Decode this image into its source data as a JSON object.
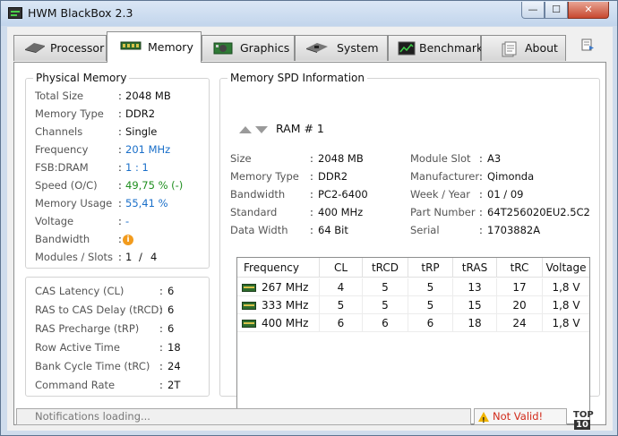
{
  "window": {
    "title": "HWM BlackBox 2.3",
    "min": "—",
    "max": "☐",
    "close": "✕"
  },
  "tabs": [
    {
      "label": "Processor",
      "icon": "cpu-icon"
    },
    {
      "label": "Memory",
      "icon": "memory-module-icon",
      "active": true
    },
    {
      "label": "Graphics",
      "icon": "graphics-card-icon"
    },
    {
      "label": "System",
      "icon": "motherboard-icon"
    },
    {
      "label": "Benchmark",
      "icon": "benchmark-chart-icon"
    },
    {
      "label": "About",
      "icon": "about-info-icon"
    }
  ],
  "physical": {
    "title": "Physical Memory",
    "rows": [
      {
        "label": "Total Size",
        "value": "2048 MB"
      },
      {
        "label": "Memory Type",
        "value": "DDR2"
      },
      {
        "label": "Channels",
        "value": "Single"
      },
      {
        "label": "Frequency",
        "value": "201 MHz"
      },
      {
        "label": "FSB:DRAM",
        "value": "1 : 1"
      },
      {
        "label": "Speed (O/C)",
        "value": "49,75 % (-)"
      },
      {
        "label": "Memory Usage",
        "value": "55,41 %"
      },
      {
        "label": "Voltage",
        "value": "-"
      },
      {
        "label": "Bandwidth",
        "value": "i"
      },
      {
        "label": "Modules / Slots",
        "value": "1",
        "value2": "4",
        "slash": "/"
      }
    ],
    "sep": ":"
  },
  "timings": {
    "rows": [
      {
        "label": "CAS Latency (CL)",
        "value": "6"
      },
      {
        "label": "RAS to CAS Delay (tRCD)",
        "value": "6"
      },
      {
        "label": "RAS Precharge (tRP)",
        "value": "6"
      },
      {
        "label": "Row Active Time",
        "value": "18"
      },
      {
        "label": "Bank Cycle Time (tRC)",
        "value": "24"
      },
      {
        "label": "Command Rate",
        "value": "2T"
      }
    ]
  },
  "spd": {
    "title": "Memory SPD Information",
    "ram_label": "RAM # 1",
    "left": [
      {
        "label": "Size",
        "value": "2048 MB"
      },
      {
        "label": "Memory Type",
        "value": "DDR2"
      },
      {
        "label": "Bandwidth",
        "value": "PC2-6400"
      },
      {
        "label": "Standard",
        "value": "400 MHz"
      },
      {
        "label": "Data Width",
        "value": "64 Bit"
      }
    ],
    "right": [
      {
        "label": "Module Slot",
        "value": "A3"
      },
      {
        "label": "Manufacturer",
        "value": "Qimonda"
      },
      {
        "label": "Week / Year",
        "value": "01 / 09"
      },
      {
        "label": "Part Number",
        "value": "64T256020EU2.5C2"
      },
      {
        "label": "Serial",
        "value": "1703882A"
      }
    ],
    "grid": {
      "headers": [
        "Frequency",
        "CL",
        "tRCD",
        "tRP",
        "tRAS",
        "tRC",
        "Voltage"
      ],
      "rows": [
        [
          "267 MHz",
          "4",
          "5",
          "5",
          "13",
          "17",
          "1,8 V"
        ],
        [
          "333 MHz",
          "5",
          "5",
          "5",
          "15",
          "20",
          "1,8 V"
        ],
        [
          "400 MHz",
          "6",
          "6",
          "6",
          "18",
          "24",
          "1,8 V"
        ]
      ]
    }
  },
  "status": {
    "notifications": "Notifications loading...",
    "warning": "Not Valid!",
    "top_a": "TOP",
    "top_b": "10"
  }
}
